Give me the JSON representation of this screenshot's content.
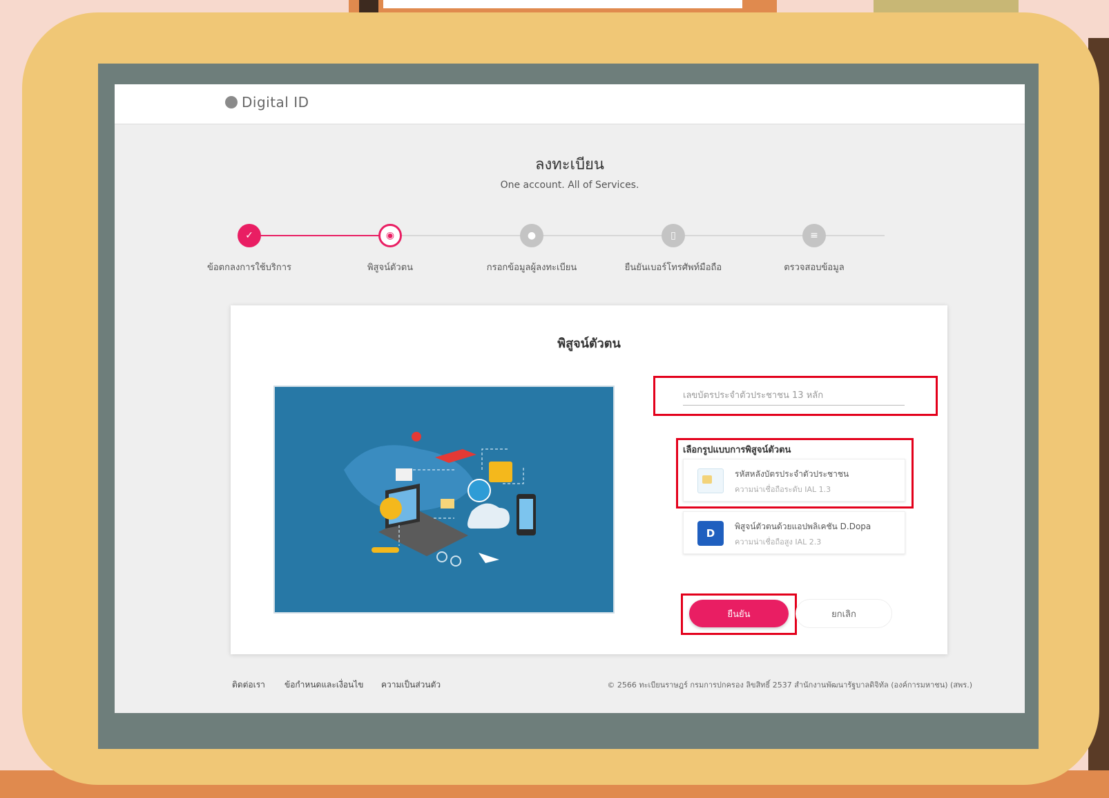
{
  "header": {
    "logo_text": "Digital ID"
  },
  "page": {
    "title": "ลงทะเบียน",
    "subtitle": "One account. All of Services."
  },
  "stepper": {
    "steps": [
      {
        "label": "ข้อตกลงการใช้บริการ",
        "state": "done",
        "icon": "check-icon",
        "glyph": "✓"
      },
      {
        "label": "พิสูจน์ตัวตน",
        "state": "active",
        "icon": "fingerprint-icon",
        "glyph": "◉"
      },
      {
        "label": "กรอกข้อมูลผู้ลงทะเบียน",
        "state": "pending",
        "icon": "user-icon",
        "glyph": "●"
      },
      {
        "label": "ยืนยันเบอร์โทรศัพท์มือถือ",
        "state": "pending",
        "icon": "phone-icon",
        "glyph": "▯"
      },
      {
        "label": "ตรวจสอบข้อมูล",
        "state": "pending",
        "icon": "review-icon",
        "glyph": "≡"
      }
    ]
  },
  "card": {
    "title": "พิสูจน์ตัวตน",
    "id_input": {
      "placeholder": "เลขบัตรประจำตัวประชาชน 13 หลัก",
      "value": ""
    },
    "method_title": "เลือกรูปแบบการพิสูจน์ตัวตน",
    "options": [
      {
        "title": "รหัสหลังบัตรประจำตัวประชาชน",
        "subtitle": "ความน่าเชื่อถือระดับ IAL 1.3",
        "icon": "id-card-icon"
      },
      {
        "title": "พิสูจน์ตัวตนด้วยแอปพลิเคชัน D.Dopa",
        "subtitle": "ความน่าเชื่อถือสูง IAL 2.3",
        "icon": "dopa-app-icon",
        "icon_text": "D"
      }
    ],
    "buttons": {
      "confirm": "ยืนยัน",
      "cancel": "ยกเลิก"
    }
  },
  "footer": {
    "links": [
      "ติดต่อเรา",
      "ข้อกำหนดและเงื่อนไข",
      "ความเป็นส่วนตัว"
    ],
    "copyright": "© 2566 ทะเบียนราษฎร์ กรมการปกครอง ลิขสิทธิ์ 2537 สำนักงานพัฒนารัฐบาลดิจิทัล (องค์การมหาชน) (สพร.)"
  },
  "colors": {
    "accent": "#e91e63",
    "highlight": "#e3001b",
    "illustration_bg": "#2778a6"
  }
}
